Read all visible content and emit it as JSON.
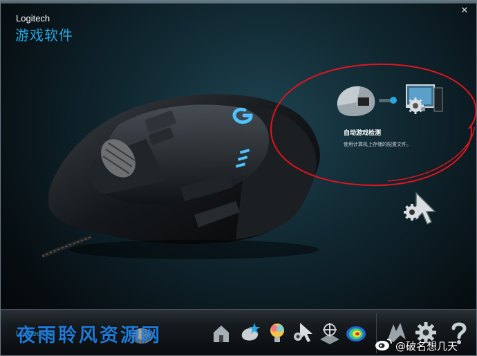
{
  "window": {
    "brand": "Logitech",
    "title": "游戏软件",
    "close_label": "✕"
  },
  "auto_detect": {
    "title": "自动游戏检测",
    "description": "使用计算机上存储的配置文件。"
  },
  "bottom_bar": {
    "logo": "Logitech G",
    "watermark": "夜雨聆风资源网",
    "credit": "@破名想几天"
  },
  "colors": {
    "accent_blue": "#27a8e0",
    "annotation_red": "#e0141e",
    "mouse_glow": "#4fc3ff"
  }
}
